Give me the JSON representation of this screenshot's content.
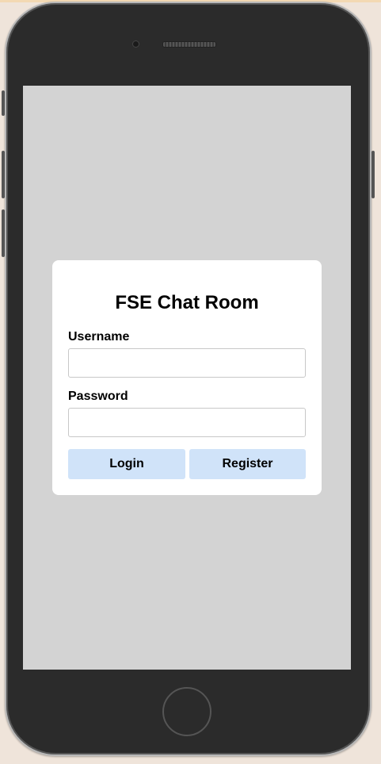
{
  "app": {
    "title": "FSE Chat Room"
  },
  "login_form": {
    "username_label": "Username",
    "username_value": "",
    "password_label": "Password",
    "password_value": "",
    "login_label": "Login",
    "register_label": "Register"
  },
  "colors": {
    "screen_background": "#d3d3d3",
    "card_background": "#ffffff",
    "button_background": "#d0e3f9",
    "device_body": "#2b2b2b"
  },
  "icons": {
    "camera": "camera-icon",
    "speaker": "speaker-grille",
    "home": "home-button"
  }
}
